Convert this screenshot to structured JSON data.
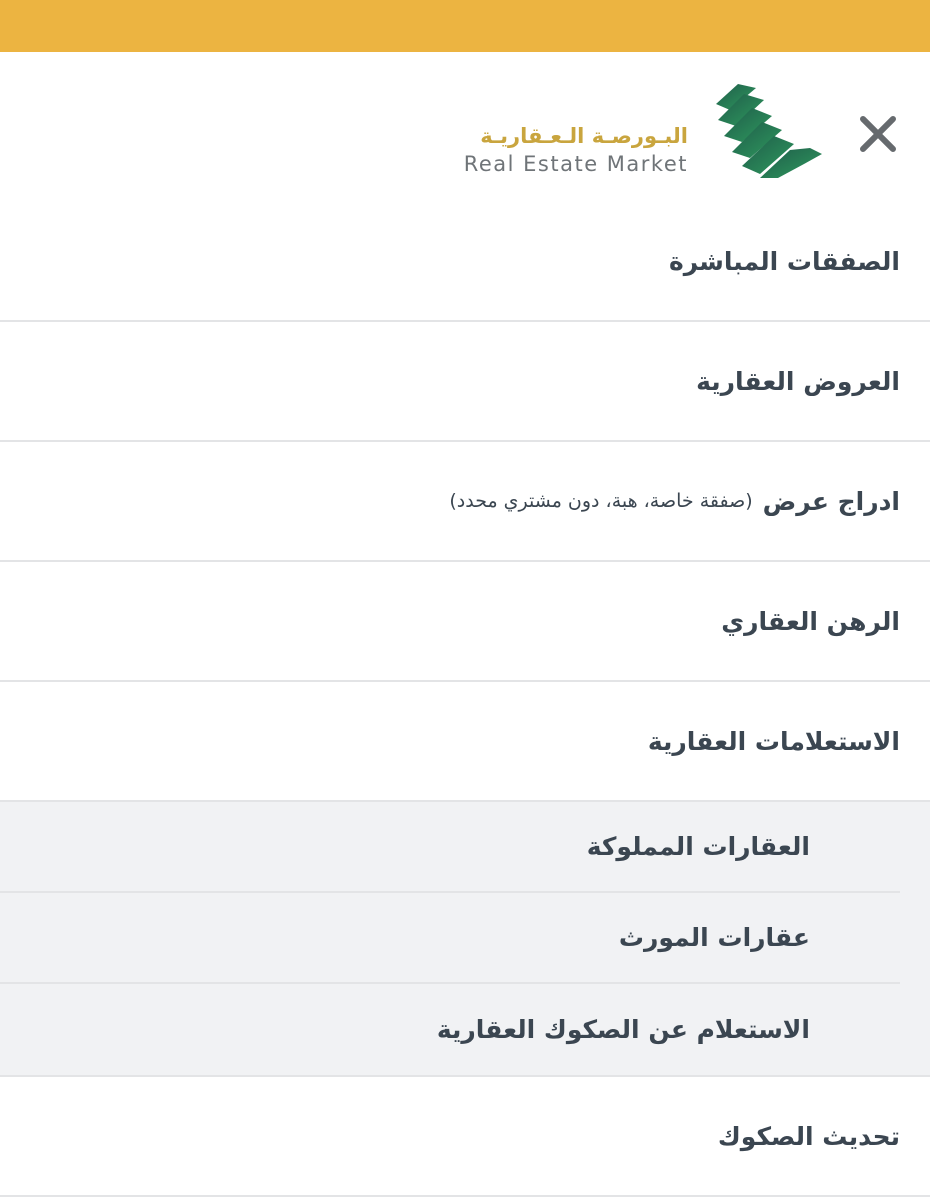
{
  "header": {
    "logo_ar": "البـورصـة الـعـقاريـة",
    "logo_en": "Real Estate Market",
    "close_icon": "close-icon",
    "colors": {
      "top_bar": "#ecb441",
      "logo_gold": "#c9a53e",
      "logo_green_dark": "#1f5c4a",
      "logo_green_light": "#2f9a5e"
    }
  },
  "menu": {
    "items": [
      {
        "label": "الصفقات المباشرة"
      },
      {
        "label": "العروض العقارية"
      },
      {
        "label": "ادراج عرض",
        "note": "(صفقة خاصة، هبة، دون مشتري محدد)"
      },
      {
        "label": "الرهن العقاري"
      },
      {
        "label": "الاستعلامات العقارية"
      }
    ],
    "subitems": [
      {
        "label": "العقارات المملوكة"
      },
      {
        "label": "عقارات المورث"
      },
      {
        "label": "الاستعلام عن الصكوك العقارية"
      }
    ],
    "after": [
      {
        "label": "تحديث الصكوك"
      }
    ]
  }
}
